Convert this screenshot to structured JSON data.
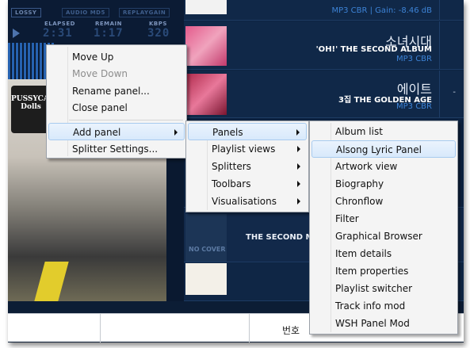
{
  "player": {
    "tags": [
      "LOSSY",
      "AUDIO MD5",
      "REPLAYGAIN"
    ],
    "meters": [
      {
        "label": "ELAPSED",
        "value": "2:31"
      },
      {
        "label": "REMAIN",
        "value": "1:17"
      },
      {
        "label": "KBPS",
        "value": "320"
      }
    ],
    "cover_text": "PUSSYCAT Dolls"
  },
  "playlist": {
    "rows": [
      {
        "title": "",
        "album": "",
        "format": "MP3 CBR | Gain: -8.46 dB"
      },
      {
        "title": "소녀시대",
        "album": "'OH!' THE SECOND ALBUM",
        "format": "MP3 CBR"
      },
      {
        "title": "에이트",
        "album": "3집 THE GOLDEN AGE",
        "format": "MP3 CBR"
      }
    ],
    "nocover_label": "NO COVER",
    "second_row_album": "THE SECOND M",
    "dash": "-"
  },
  "bottom_bar": {
    "column_label": "번호"
  },
  "context_menu": {
    "items": [
      {
        "label": "Move Up",
        "enabled": true
      },
      {
        "label": "Move Down",
        "enabled": false
      },
      {
        "label": "Rename panel...",
        "enabled": true
      },
      {
        "label": "Close panel",
        "enabled": true
      },
      {
        "label": "Add panel",
        "enabled": true,
        "submenu": true,
        "highlighted": true
      },
      {
        "label": "Splitter Settings...",
        "enabled": true
      }
    ]
  },
  "add_panel_menu": {
    "items": [
      {
        "label": "Panels",
        "highlighted": true
      },
      {
        "label": "Playlist views"
      },
      {
        "label": "Splitters"
      },
      {
        "label": "Toolbars"
      },
      {
        "label": "Visualisations"
      }
    ]
  },
  "panels_menu": {
    "items": [
      "Album list",
      "Alsong Lyric Panel",
      "Artwork view",
      "Biography",
      "Chronflow",
      "Filter",
      "Graphical Browser",
      "Item details",
      "Item properties",
      "Playlist switcher",
      "Track info mod",
      "WSH Panel Mod"
    ],
    "highlighted_index": 1
  }
}
